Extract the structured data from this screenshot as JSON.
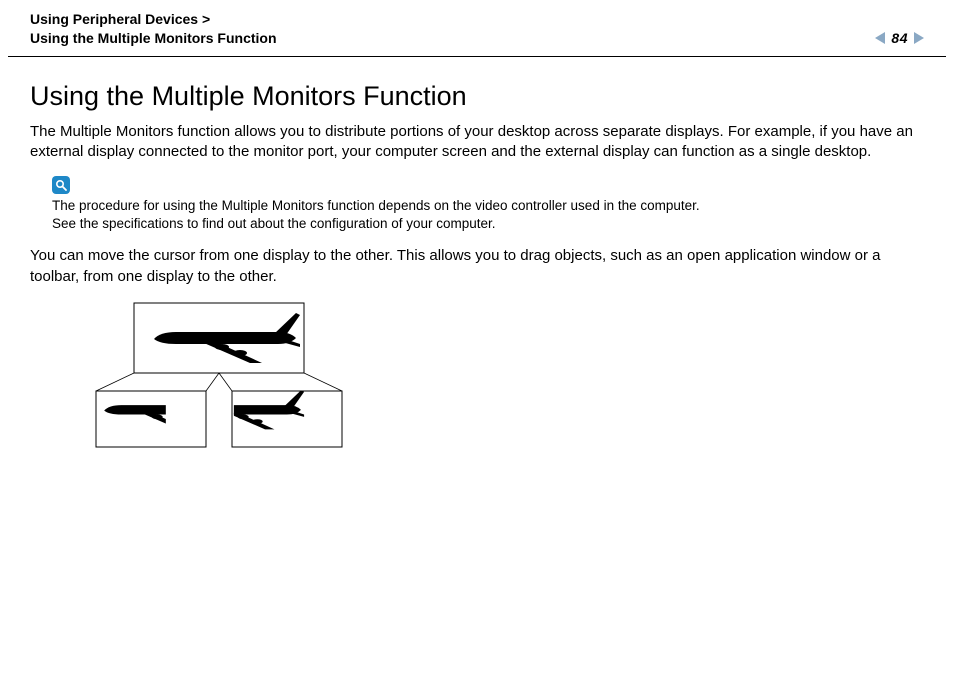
{
  "header": {
    "breadcrumb_parent": "Using Peripheral Devices >",
    "breadcrumb_current": "Using the Multiple Monitors Function",
    "page_number": "84"
  },
  "title": "Using the Multiple Monitors Function",
  "intro": "The Multiple Monitors function allows you to distribute portions of your desktop across separate displays. For example, if you have an external display connected to the monitor port, your computer screen and the external display can function as a single desktop.",
  "note": {
    "icon": "search-icon",
    "line1": "The procedure for using the Multiple Monitors function depends on the video controller used in the computer.",
    "line2": "See the specifications to find out about the configuration of your computer."
  },
  "body2": "You can move the cursor from one display to the other. This allows you to drag objects, such as an open application window or a toolbar, from one display to the other.",
  "diagram": {
    "alt": "One large display showing a full airplane, split into two smaller displays each showing half of the airplane"
  }
}
